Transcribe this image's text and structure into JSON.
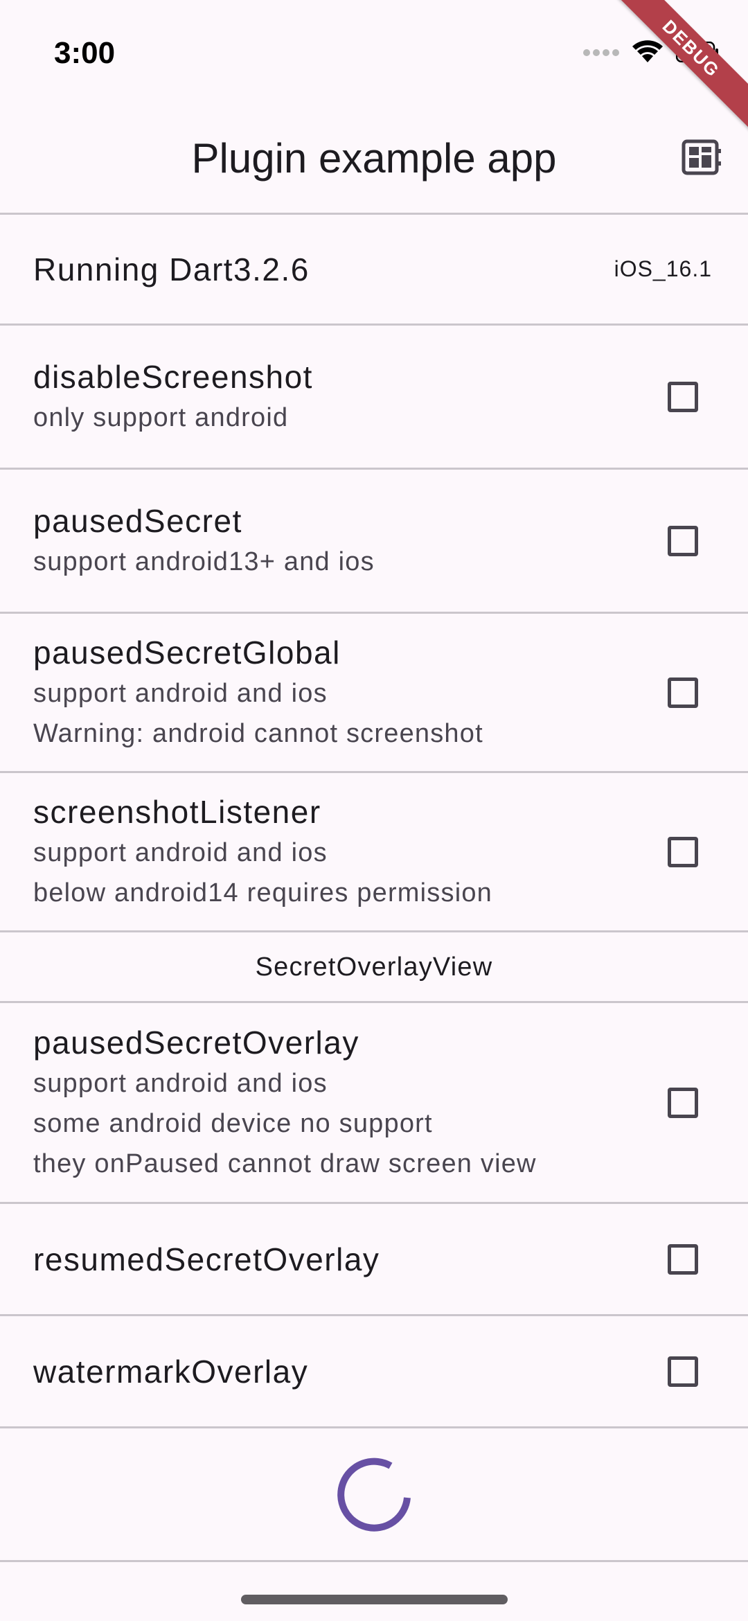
{
  "status_bar": {
    "time": "3:00",
    "icons": [
      "signal-dots-icon",
      "wifi-icon",
      "battery-icon"
    ]
  },
  "debug_banner": "DEBUG",
  "app_bar": {
    "title": "Plugin example app",
    "action_icon": "dashboard-icon"
  },
  "info_row": {
    "running": "Running Dart3.2.6",
    "platform": "iOS_16.1"
  },
  "options": [
    {
      "title": "disableScreenshot",
      "lines": [
        "only support android"
      ],
      "checked": false
    },
    {
      "title": "pausedSecret",
      "lines": [
        "support android13+ and ios"
      ],
      "checked": false
    },
    {
      "title": "pausedSecretGlobal",
      "lines": [
        "support android and ios",
        "Warning: android cannot screenshot"
      ],
      "checked": false
    },
    {
      "title": "screenshotListener",
      "lines": [
        "support android and ios",
        "below android14 requires permission"
      ],
      "checked": false
    }
  ],
  "section_header": "SecretOverlayView",
  "overlay_options": [
    {
      "title": "pausedSecretOverlay",
      "lines": [
        "support android and ios",
        "some android device no support",
        "they onPaused cannot draw screen view"
      ],
      "checked": false
    },
    {
      "title": "resumedSecretOverlay",
      "lines": [],
      "checked": false
    },
    {
      "title": "watermarkOverlay",
      "lines": [],
      "checked": false
    }
  ],
  "colors": {
    "background": "#fdf8fc",
    "divider": "#cbc6cc",
    "spinner": "#6750a4",
    "debug_banner": "#b3404a"
  }
}
